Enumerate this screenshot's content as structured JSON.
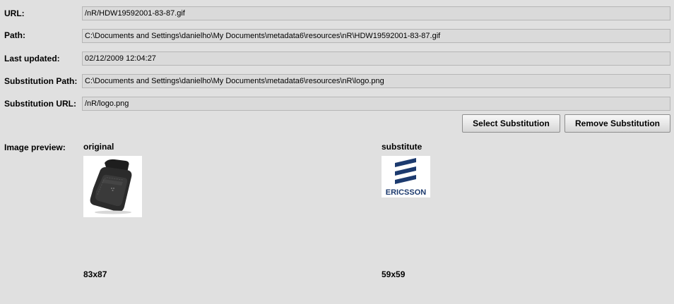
{
  "fields": [
    {
      "label": "URL:",
      "value": "/nR/HDW19592001-83-87.gif"
    },
    {
      "label": "Path:",
      "value": "C:\\Documents and Settings\\danielho\\My Documents\\metadata6\\resources\\nR\\HDW19592001-83-87.gif"
    },
    {
      "label": "Last updated:",
      "value": "02/12/2009 12:04:27"
    },
    {
      "label": "Substitution Path:",
      "value": "C:\\Documents and Settings\\danielho\\My Documents\\metadata6\\resources\\nR\\logo.png"
    },
    {
      "label": "Substitution URL:",
      "value": "/nR/logo.png"
    }
  ],
  "buttons": {
    "select_substitution": "Select Substitution",
    "remove_substitution": "Remove Substitution"
  },
  "preview": {
    "label": "Image preview:",
    "original": {
      "title": "original",
      "dimensions": "83x87",
      "icon": "phone-holster-image"
    },
    "substitute": {
      "title": "substitute",
      "dimensions": "59x59",
      "icon": "ericsson-logo-image",
      "logo_text": "ERICSSON"
    }
  },
  "colors": {
    "background": "#e0e0e0",
    "field_bg": "#dadada",
    "ericsson_blue": "#1c3a6e"
  }
}
